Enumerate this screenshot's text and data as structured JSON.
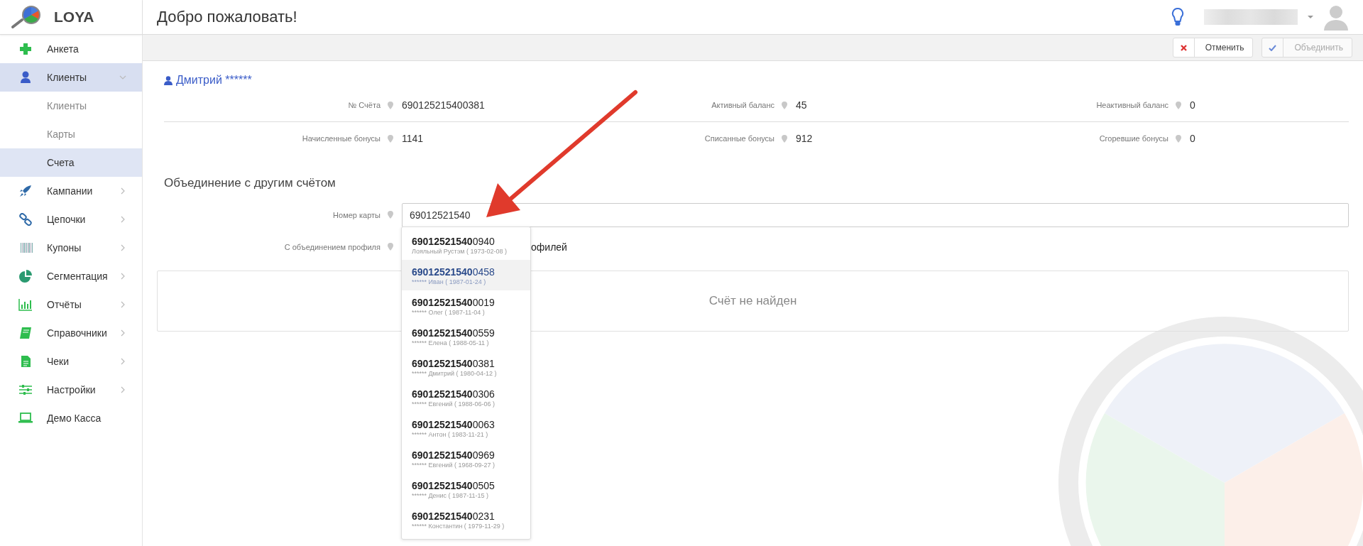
{
  "brand": {
    "name": "LOYA"
  },
  "sidebar": {
    "items": [
      {
        "label": "Анкета",
        "kind": "link",
        "selected": false
      },
      {
        "label": "Клиенты",
        "kind": "group",
        "expanded": true,
        "selected": true,
        "children": [
          {
            "label": "Клиенты",
            "selected": false
          },
          {
            "label": "Карты",
            "selected": false
          },
          {
            "label": "Счета",
            "selected": true
          }
        ]
      },
      {
        "label": "Кампании",
        "kind": "group",
        "expanded": false,
        "selected": false
      },
      {
        "label": "Цепочки",
        "kind": "group",
        "expanded": false,
        "selected": false
      },
      {
        "label": "Купоны",
        "kind": "group",
        "expanded": false,
        "selected": false
      },
      {
        "label": "Сегментация",
        "kind": "group",
        "expanded": false,
        "selected": false
      },
      {
        "label": "Отчёты",
        "kind": "group",
        "expanded": false,
        "selected": false
      },
      {
        "label": "Справочники",
        "kind": "group",
        "expanded": false,
        "selected": false
      },
      {
        "label": "Чеки",
        "kind": "group",
        "expanded": false,
        "selected": false
      },
      {
        "label": "Настройки",
        "kind": "group",
        "expanded": false,
        "selected": false
      },
      {
        "label": "Демо Касса",
        "kind": "link",
        "selected": false
      }
    ]
  },
  "header": {
    "title": "Добро пожаловать!"
  },
  "toolbar": {
    "buttons": [
      {
        "label": "Отменить",
        "kind": "cancel",
        "disabled": false
      },
      {
        "label": "Объединить",
        "kind": "confirm",
        "disabled": true
      }
    ]
  },
  "client": {
    "name": "Дмитрий ******"
  },
  "info": {
    "rows": [
      [
        {
          "label": "№ Счёта",
          "value": "690125215400381"
        },
        {
          "label": "Активный баланс",
          "value": "45"
        },
        {
          "label": "Неактивный баланс",
          "value": "0"
        }
      ],
      [
        {
          "label": "Начисленные бонусы",
          "value": "1141"
        },
        {
          "label": "Списанные бонусы",
          "value": "912"
        },
        {
          "label": "Сгоревшие бонусы",
          "value": "0"
        }
      ]
    ]
  },
  "merge": {
    "title": "Объединение с другим счётом",
    "card_field": {
      "label": "Номер карты",
      "value": "69012521540"
    },
    "profile_field": {
      "label": "С объединением профиля",
      "text": "офилей"
    },
    "result": "Счёт не найден"
  },
  "suggestions": [
    {
      "number": "**69012521540**0940",
      "detail": "Лояльный Рустэм ( 1973-02-08 )",
      "selected": false
    },
    {
      "number": "**69012521540**0458",
      "detail": "****** Иван ( 1987-01-24 )",
      "selected": true
    },
    {
      "number": "**69012521540**0019",
      "detail": "****** Олег ( 1987-11-04 )",
      "selected": false
    },
    {
      "number": "**69012521540**0559",
      "detail": "****** Елена ( 1988-05-11 )",
      "selected": false
    },
    {
      "number": "**69012521540**0381",
      "detail": "****** Дмитрий ( 1980-04-12 )",
      "selected": false
    },
    {
      "number": "**69012521540**0306",
      "detail": "****** Евгений ( 1988-06-06 )",
      "selected": false
    },
    {
      "number": "**69012521540**0063",
      "detail": "****** Антон ( 1983-11-21 )",
      "selected": false
    },
    {
      "number": "**69012521540**0969",
      "detail": "****** Евгений ( 1968-09-27 )",
      "selected": false
    },
    {
      "number": "**69012521540**0505",
      "detail": "****** Денис ( 1987-11-15 )",
      "selected": false
    },
    {
      "number": "**69012521540**0231",
      "detail": "****** Константин ( 1979-11-29 )",
      "selected": false
    }
  ]
}
